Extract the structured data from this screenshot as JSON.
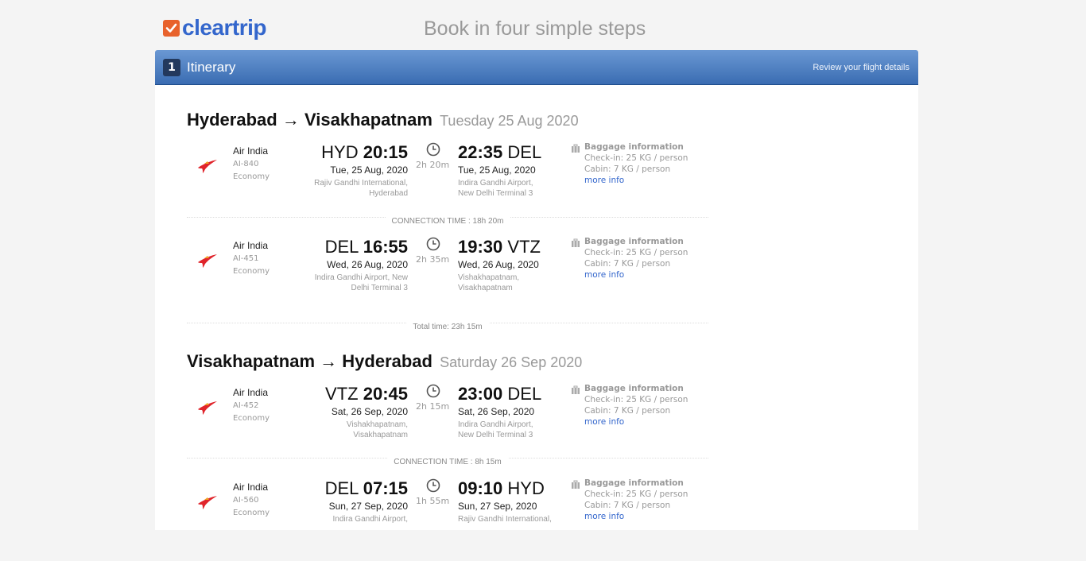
{
  "brand": {
    "name": "cleartrip",
    "accent": "#e8622c",
    "primary": "#3366cc"
  },
  "page_title": "Book in four simple steps",
  "step": {
    "number": "1",
    "label": "Itinerary",
    "hint": "Review your flight details"
  },
  "trips": [
    {
      "from": "Hyderabad",
      "arrow": "→",
      "to": "Visakhapatnam",
      "date": "Tuesday 25 Aug 2020",
      "segments": [
        {
          "airline": "Air India",
          "flight_no": "AI-840",
          "cabin": "Economy",
          "dep_code": "HYD",
          "dep_time": "20:15",
          "dep_date": "Tue, 25 Aug, 2020",
          "dep_airport_1": "Rajiv Gandhi International,",
          "dep_airport_2": "Hyderabad",
          "duration": "2h 20m",
          "arr_time": "22:35",
          "arr_code": "DEL",
          "arr_date": "Tue, 25 Aug, 2020",
          "arr_airport_1": "Indira Gandhi Airport,",
          "arr_airport_2": "New Delhi Terminal 3",
          "bag_title": "Baggage information",
          "bag_checkin": "Check-in: 25 KG / person",
          "bag_cabin": "Cabin: 7 KG / person",
          "more": "more info"
        },
        {
          "airline": "Air India",
          "flight_no": "AI-451",
          "cabin": "Economy",
          "dep_code": "DEL",
          "dep_time": "16:55",
          "dep_date": "Wed, 26 Aug, 2020",
          "dep_airport_1": "Indira Gandhi Airport, New",
          "dep_airport_2": "Delhi Terminal 3",
          "duration": "2h 35m",
          "arr_time": "19:30",
          "arr_code": "VTZ",
          "arr_date": "Wed, 26 Aug, 2020",
          "arr_airport_1": "Vishakhapatnam,",
          "arr_airport_2": "Visakhapatnam",
          "bag_title": "Baggage information",
          "bag_checkin": "Check-in: 25 KG / person",
          "bag_cabin": "Cabin: 7 KG / person",
          "more": "more info"
        }
      ],
      "connection": "CONNECTION TIME : 18h 20m",
      "total": "Total time: 23h 15m"
    },
    {
      "from": "Visakhapatnam",
      "arrow": "→",
      "to": "Hyderabad",
      "date": "Saturday 26 Sep 2020",
      "segments": [
        {
          "airline": "Air India",
          "flight_no": "AI-452",
          "cabin": "Economy",
          "dep_code": "VTZ",
          "dep_time": "20:45",
          "dep_date": "Sat, 26 Sep, 2020",
          "dep_airport_1": "Vishakhapatnam,",
          "dep_airport_2": "Visakhapatnam",
          "duration": "2h 15m",
          "arr_time": "23:00",
          "arr_code": "DEL",
          "arr_date": "Sat, 26 Sep, 2020",
          "arr_airport_1": "Indira Gandhi Airport,",
          "arr_airport_2": "New Delhi Terminal 3",
          "bag_title": "Baggage information",
          "bag_checkin": "Check-in: 25 KG / person",
          "bag_cabin": "Cabin: 7 KG / person",
          "more": "more info"
        },
        {
          "airline": "Air India",
          "flight_no": "AI-560",
          "cabin": "Economy",
          "dep_code": "DEL",
          "dep_time": "07:15",
          "dep_date": "Sun, 27 Sep, 2020",
          "dep_airport_1": "Indira Gandhi Airport,",
          "dep_airport_2": "",
          "duration": "1h 55m",
          "arr_time": "09:10",
          "arr_code": "HYD",
          "arr_date": "Sun, 27 Sep, 2020",
          "arr_airport_1": "Rajiv Gandhi International,",
          "arr_airport_2": "",
          "bag_title": "Baggage information",
          "bag_checkin": "Check-in: 25 KG / person",
          "bag_cabin": "Cabin: 7 KG / person",
          "more": "more info"
        }
      ],
      "connection": "CONNECTION TIME : 8h 15m"
    }
  ]
}
